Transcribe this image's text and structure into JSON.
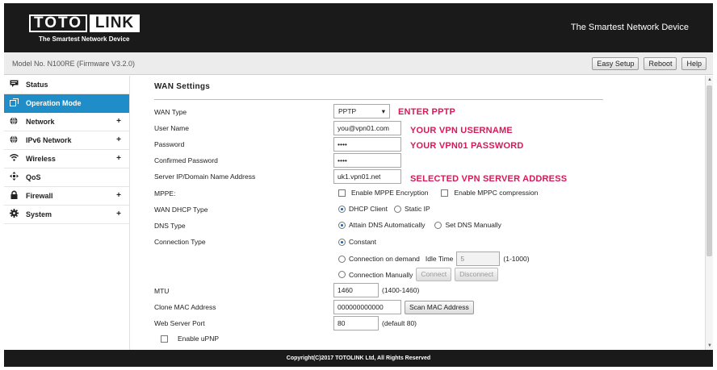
{
  "header": {
    "logo_left": "TOTO",
    "logo_right": "LINK",
    "logo_tagline": "The Smartest Network Device",
    "right_text": "The Smartest Network Device"
  },
  "modelbar": {
    "model": "Model No. N100RE (Firmware V3.2.0)",
    "easy_setup": "Easy Setup",
    "reboot": "Reboot",
    "help": "Help"
  },
  "sidebar": {
    "items": [
      {
        "label": "Status",
        "icon": "status-icon",
        "expandable": false
      },
      {
        "label": "Operation Mode",
        "icon": "operation-mode-icon",
        "expandable": false
      },
      {
        "label": "Network",
        "icon": "globe-icon",
        "expandable": true
      },
      {
        "label": "IPv6 Network",
        "icon": "globe-icon",
        "expandable": true
      },
      {
        "label": "Wireless",
        "icon": "wifi-icon",
        "expandable": true
      },
      {
        "label": "QoS",
        "icon": "qos-icon",
        "expandable": false
      },
      {
        "label": "Firewall",
        "icon": "lock-icon",
        "expandable": true
      },
      {
        "label": "System",
        "icon": "gear-icon",
        "expandable": true
      }
    ],
    "plus": "+"
  },
  "main": {
    "title": "WAN Settings",
    "labels": {
      "wan_type": "WAN Type",
      "user_name": "User Name",
      "password": "Password",
      "confirmed_password": "Confirmed Password",
      "server": "Server IP/Domain Name Address",
      "mppe": "MPPE:",
      "wan_dhcp_type": "WAN DHCP Type",
      "dns_type": "DNS Type",
      "connection_type": "Connection Type",
      "mtu": "MTU",
      "clone_mac": "Clone MAC Address",
      "web_port": "Web Server Port"
    },
    "values": {
      "wan_type": "PPTP",
      "user_name": "you@vpn01.com",
      "password": "••••",
      "confirmed_password": "••••",
      "server": "uk1.vpn01.net",
      "idle_time": "5",
      "mtu": "1460",
      "clone_mac": "000000000000",
      "web_port": "80"
    },
    "options": {
      "enable_mppe": "Enable MPPE Encryption",
      "enable_mppc": "Enable MPPC compression",
      "dhcp_client": "DHCP Client",
      "static_ip": "Static IP",
      "attain_dns": "Attain DNS Automatically",
      "set_dns": "Set DNS Manually",
      "constant": "Constant",
      "on_demand": "Connection on demand",
      "idle_time_label": "Idle Time",
      "idle_range": "(1-1000)",
      "manually": "Connection Manually",
      "connect": "Connect",
      "disconnect": "Disconnect",
      "mtu_range": "(1400-1460)",
      "scan_mac": "Scan MAC Address",
      "port_default": "(default 80)",
      "enable_upnp": "Enable uPNP"
    },
    "notes": {
      "enter_pptp": "ENTER PPTP",
      "username": "YOUR VPN USERNAME",
      "password": "YOUR VPN01 PASSWORD",
      "server": "SELECTED VPN SERVER ADDRESS"
    },
    "selections": {
      "wan_dhcp_type": "DHCP Client",
      "dns_type": "Attain DNS Automatically",
      "connection_type": "Constant"
    }
  },
  "footer": {
    "text": "Copyright(C)2017 TOTOLINK Ltd, All Rights Reserved"
  },
  "colors": {
    "header_bg": "#1a1a1a",
    "active_nav": "#1e8dc8",
    "annotation": "#d6195a"
  }
}
